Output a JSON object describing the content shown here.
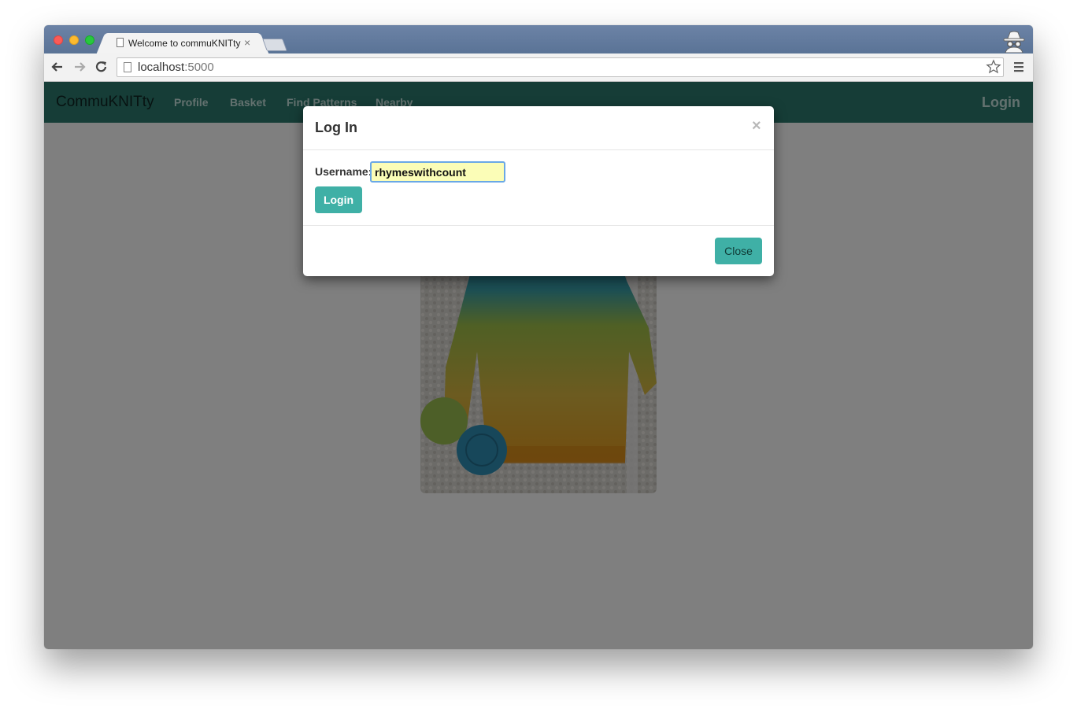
{
  "browser": {
    "tab_title": "Welcome to commuKNITty",
    "tab_close": "×",
    "url_host": "localhost",
    "url_port": ":5000"
  },
  "app": {
    "brand": "CommuKNITty",
    "nav": [
      {
        "label": "Profile"
      },
      {
        "label": "Basket"
      },
      {
        "label": "Find Patterns"
      },
      {
        "label": "Nearby"
      }
    ],
    "login_link": "Login",
    "colors": {
      "navbar": "#2c7a6e",
      "button": "#3fb0a6"
    }
  },
  "modal": {
    "title": "Log In",
    "close_x": "×",
    "username_label": "Username:",
    "username_value": "rhymeswithcount",
    "login_button": "Login",
    "close_button": "Close"
  }
}
